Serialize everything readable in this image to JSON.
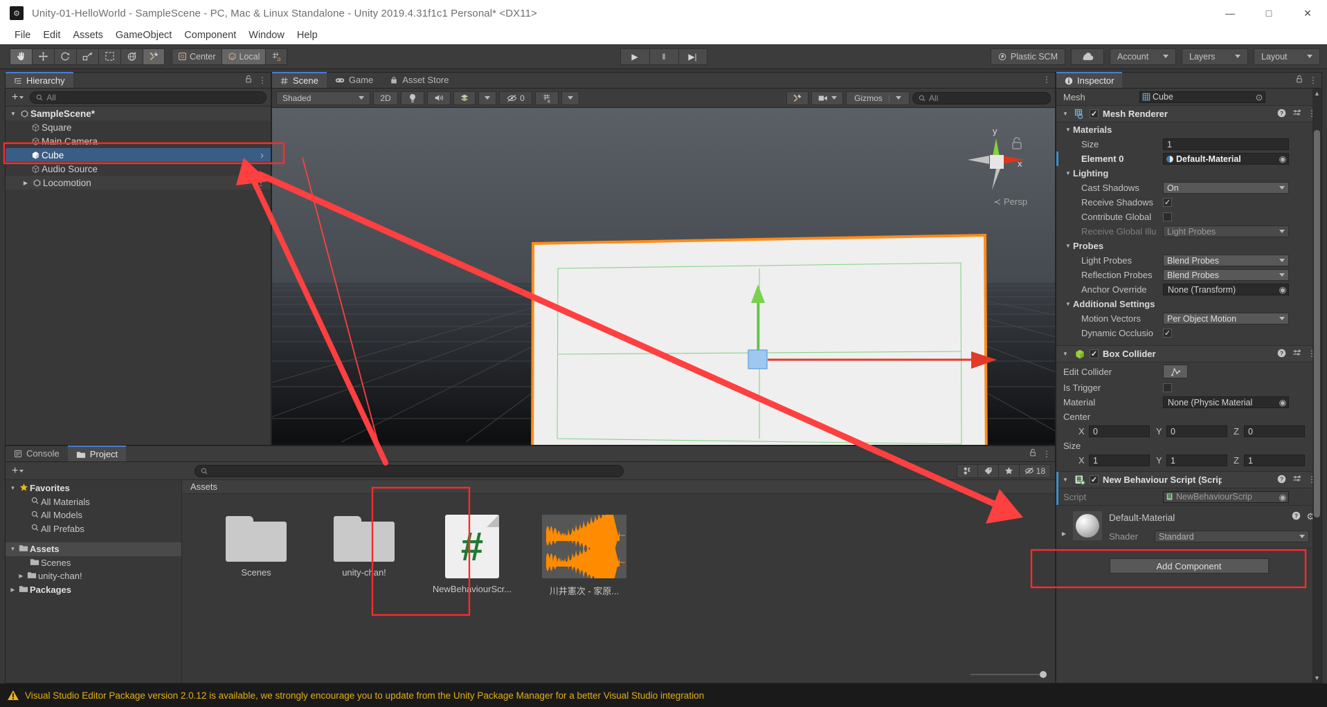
{
  "window": {
    "title": "Unity-01-HelloWorld - SampleScene - PC, Mac & Linux Standalone - Unity 2019.4.31f1c1 Personal* <DX11>",
    "app_icon": "unity-icon",
    "minimize": "—",
    "maximize": "□",
    "close": "✕"
  },
  "menubar": {
    "items": [
      "File",
      "Edit",
      "Assets",
      "GameObject",
      "Component",
      "Window",
      "Help"
    ]
  },
  "toolbar": {
    "tools": [
      {
        "name": "hand-tool",
        "glyph": "✋",
        "active": true
      },
      {
        "name": "move-tool",
        "glyph": "✚",
        "active": false
      },
      {
        "name": "rotate-tool",
        "glyph": "↺",
        "active": false
      },
      {
        "name": "scale-tool",
        "glyph": "⤡",
        "active": false
      },
      {
        "name": "rect-tool",
        "glyph": "⬚",
        "active": false
      },
      {
        "name": "transform-tool",
        "glyph": "⬤",
        "active": false
      },
      {
        "name": "custom-editor-tool",
        "glyph": "⚒",
        "active": true
      }
    ],
    "pivot_label": "Center",
    "space_label": "Local",
    "grid_snap_label": "grid-snap",
    "play": "▶",
    "pause": "‖",
    "step": "▶|",
    "plastic_scm": "Plastic SCM",
    "cloud": "cloud-icon",
    "account": "Account",
    "layers": "Layers",
    "layout": "Layout"
  },
  "hierarchy": {
    "tab_label": "Hierarchy",
    "tab_icon": "hierarchy-icon",
    "lock_icon": "🔓",
    "kebab": "⋮",
    "add_label": "+",
    "search_placeholder": "All",
    "items": [
      {
        "label": "SampleScene*",
        "icon": "scene-icon",
        "depth": 0,
        "expanded": true,
        "selected": false,
        "kebab": true,
        "bold": true
      },
      {
        "label": "Square",
        "icon": "cube-outline-icon",
        "depth": 1,
        "selected": false
      },
      {
        "label": "Main Camera",
        "icon": "cube-outline-icon",
        "depth": 1,
        "selected": false
      },
      {
        "label": "Cube",
        "icon": "cube-solid-icon",
        "depth": 1,
        "selected": true,
        "chevron": "›"
      },
      {
        "label": "Audio Source",
        "icon": "cube-outline-icon",
        "depth": 1,
        "selected": false
      },
      {
        "label": "Locomotion",
        "icon": "scene-icon",
        "depth": 0,
        "expanded": false,
        "selected": false,
        "kebab": true
      }
    ]
  },
  "sceneview": {
    "tabs": [
      {
        "label": "Scene",
        "icon": "scene-grid-icon",
        "active": true
      },
      {
        "label": "Game",
        "icon": "gamepad-icon",
        "active": false
      },
      {
        "label": "Asset Store",
        "icon": "store-icon",
        "active": false
      }
    ],
    "kebab": "⋮",
    "draw_mode": "Shaded",
    "mode_2d": "2D",
    "light_icon": "lightbulb-icon",
    "audio_icon": "speaker-icon",
    "fx_icon": "effects-icon",
    "hidden_count": "0",
    "hidden_icon": "eye-slash-icon",
    "grid_icon": "grid-axis-icon",
    "tools_icon": "scene-tools-icon",
    "camera_icon": "camera-icon",
    "gizmos_label": "Gizmos",
    "search_placeholder": "All",
    "axis_gizmo": {
      "y_label": "y",
      "x_label": "x",
      "lock_icon": "lock-icon"
    },
    "projection_label": "Persp"
  },
  "inspector": {
    "tab_label": "Inspector",
    "tab_icon": "info-icon",
    "lock_icon": "🔓",
    "kebab": "⋮",
    "mesh_row": {
      "label": "Mesh",
      "value": "Cube",
      "icon": "mesh-icon",
      "picker": "⊙"
    },
    "components": [
      {
        "name": "Mesh Renderer",
        "icon": "mesh-renderer-icon",
        "enabled": true,
        "help": "?",
        "preset": "⇲",
        "kebab": "⋮",
        "groups": [
          {
            "title": "Materials",
            "rows": [
              {
                "label": "Size",
                "value": "1",
                "type": "field"
              },
              {
                "label": "Element 0",
                "value": "Default-Material",
                "type": "object",
                "bold": true,
                "icon": "material-icon"
              }
            ]
          },
          {
            "title": "Lighting",
            "rows": [
              {
                "label": "Cast Shadows",
                "value": "On",
                "type": "dropdown"
              },
              {
                "label": "Receive Shadows",
                "value": "",
                "type": "checkbox",
                "checked": true
              },
              {
                "label": "Contribute Global",
                "value": "",
                "type": "checkbox",
                "checked": false
              },
              {
                "label": "Receive Global Illu",
                "value": "Light Probes",
                "type": "dropdown",
                "disabled": true
              }
            ]
          },
          {
            "title": "Probes",
            "rows": [
              {
                "label": "Light Probes",
                "value": "Blend Probes",
                "type": "dropdown"
              },
              {
                "label": "Reflection Probes",
                "value": "Blend Probes",
                "type": "dropdown"
              },
              {
                "label": "Anchor Override",
                "value": "None (Transform)",
                "type": "object"
              }
            ]
          },
          {
            "title": "Additional Settings",
            "rows": [
              {
                "label": "Motion Vectors",
                "value": "Per Object Motion",
                "type": "dropdown"
              },
              {
                "label": "Dynamic Occlusio",
                "value": "",
                "type": "checkbox",
                "checked": true
              }
            ]
          }
        ]
      },
      {
        "name": "Box Collider",
        "icon": "box-collider-icon",
        "enabled": true,
        "help": "?",
        "preset": "⇲",
        "kebab": "⋮",
        "rows": [
          {
            "label": "Edit Collider",
            "value": "",
            "type": "edit-button"
          },
          {
            "label": "Is Trigger",
            "value": "",
            "type": "checkbox",
            "checked": false
          },
          {
            "label": "Material",
            "value": "None (Physic Material",
            "type": "object"
          },
          {
            "label": "Center",
            "type": "vector3",
            "x": "0",
            "y": "0",
            "z": "0"
          },
          {
            "label": "Size",
            "type": "vector3",
            "x": "1",
            "y": "1",
            "z": "1"
          }
        ]
      },
      {
        "name": "New Behaviour Script (Scrip",
        "icon": "cs-script-icon",
        "enabled": true,
        "help": "?",
        "preset": "⇲",
        "kebab": "⋮",
        "rows": [
          {
            "label": "Script",
            "value": "NewBehaviourScrip",
            "type": "object",
            "disabled": true,
            "icon": "cs-file-icon"
          }
        ]
      }
    ],
    "material_preview": {
      "name": "Default-Material",
      "help": "?",
      "gear": "⚙",
      "shader_label": "Shader",
      "shader_value": "Standard",
      "expander": "▶"
    },
    "add_component": "Add Component",
    "vector_axes": [
      "X",
      "Y",
      "Z"
    ]
  },
  "project": {
    "tabs": [
      {
        "label": "Console",
        "icon": "console-icon",
        "active": false
      },
      {
        "label": "Project",
        "icon": "folder-icon",
        "active": true
      }
    ],
    "lock_icon": "🔓",
    "kebab": "⋮",
    "add_label": "+",
    "search_placeholder": "",
    "toolbar_icons": [
      "save-filter-icon",
      "label-icon",
      "favorite-star-icon"
    ],
    "hidden_icon": "eye-slash-icon",
    "hidden_count": "18",
    "tree": [
      {
        "label": "Favorites",
        "icon": "star-icon",
        "depth": 0,
        "expanded": true,
        "bold": true
      },
      {
        "label": "All Materials",
        "icon": "search-icon",
        "depth": 1
      },
      {
        "label": "All Models",
        "icon": "search-icon",
        "depth": 1
      },
      {
        "label": "All Prefabs",
        "icon": "search-icon",
        "depth": 1
      },
      {
        "label": "Assets",
        "icon": "folder-icon",
        "depth": 0,
        "expanded": true,
        "bold": true,
        "selected": true
      },
      {
        "label": "Scenes",
        "icon": "folder-icon",
        "depth": 1
      },
      {
        "label": "unity-chan!",
        "icon": "folder-icon",
        "depth": 1,
        "collapsed": true
      },
      {
        "label": "Packages",
        "icon": "folder-icon",
        "depth": 0,
        "collapsed": true,
        "bold": true
      }
    ],
    "breadcrumb": "Assets",
    "grid_items": [
      {
        "label": "Scenes",
        "type": "folder",
        "selected": false
      },
      {
        "label": "unity-chan!",
        "type": "folder",
        "selected": false
      },
      {
        "label": "NewBehaviourScr...",
        "type": "script",
        "selected": true
      },
      {
        "label": "川井憲次 - 家原...",
        "type": "audio",
        "selected": false
      }
    ]
  },
  "statusbar": {
    "icon": "warning-icon",
    "message": "Visual Studio Editor Package version 2.0.12 is available, we strongly encourage you to update from the Unity Package Manager for a better Visual Studio integration"
  },
  "colors": {
    "accent_blue": "#3a5d85",
    "annotation_red": "#ff2b2b",
    "selection_orange": "#ff8c19",
    "warning_yellow": "#e0b019",
    "script_green": "#1f7a33",
    "audio_orange": "#ff8c00"
  }
}
